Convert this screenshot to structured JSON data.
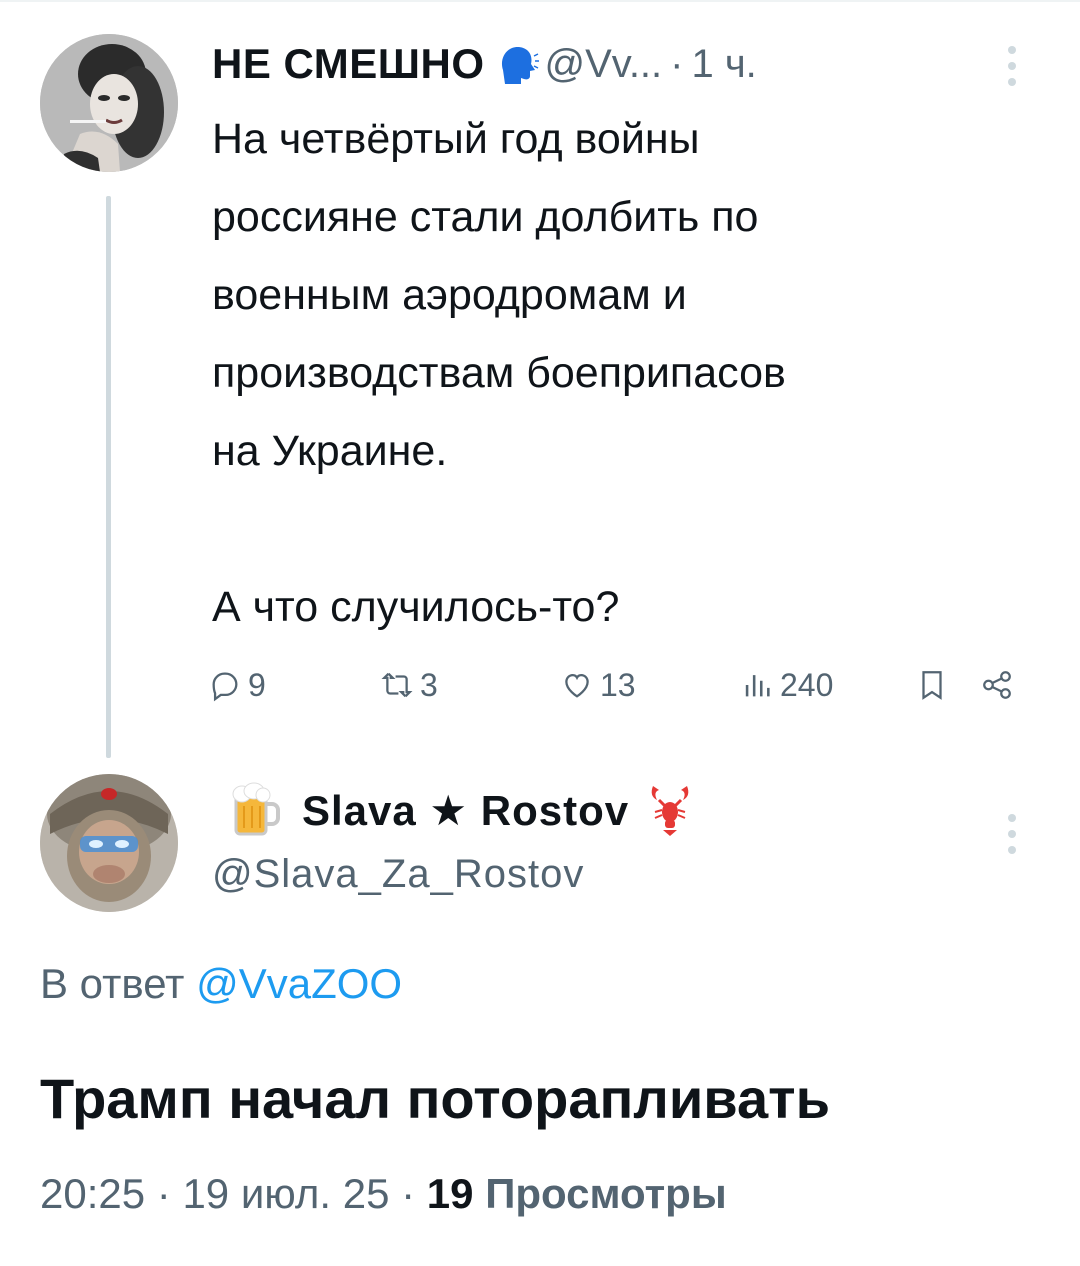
{
  "colors": {
    "text_primary": "#0f1419",
    "text_secondary": "#536471",
    "link": "#1d9bf0",
    "thread_line": "#cfd9de",
    "speak_icon": "#1d6fe0",
    "lobster": "#e53935"
  },
  "parent_tweet": {
    "author_name": "НЕ СМЕШНО",
    "handle": "@Vv...",
    "separator": "·",
    "time": "1 ч.",
    "text": "На четвёртый год войны\nроссияне стали долбить по\nвоенным аэродромам и\nпроизводствам боеприпасов\nна Украине.\n\nА что случилось-то?",
    "actions": {
      "replies": "9",
      "retweets": "3",
      "likes": "13",
      "views": "240"
    },
    "icons": [
      "speaking-head-icon",
      "more-icon",
      "reply-icon",
      "retweet-icon",
      "like-icon",
      "views-icon",
      "bookmark-icon",
      "share-icon"
    ]
  },
  "reply_tweet": {
    "display_name": "Slava ★ Rostov",
    "handle": "@Slava_Za_Rostov",
    "reply_prefix": "В ответ",
    "reply_mention": "@VvaZOO",
    "text": "Трамп начал поторапливать",
    "time": "20:25",
    "separator": "·",
    "date": "19 июл. 25",
    "views_count": "19",
    "views_label": "Просмотры",
    "icons": [
      "beer-icon",
      "lobster-icon",
      "more-icon"
    ]
  }
}
